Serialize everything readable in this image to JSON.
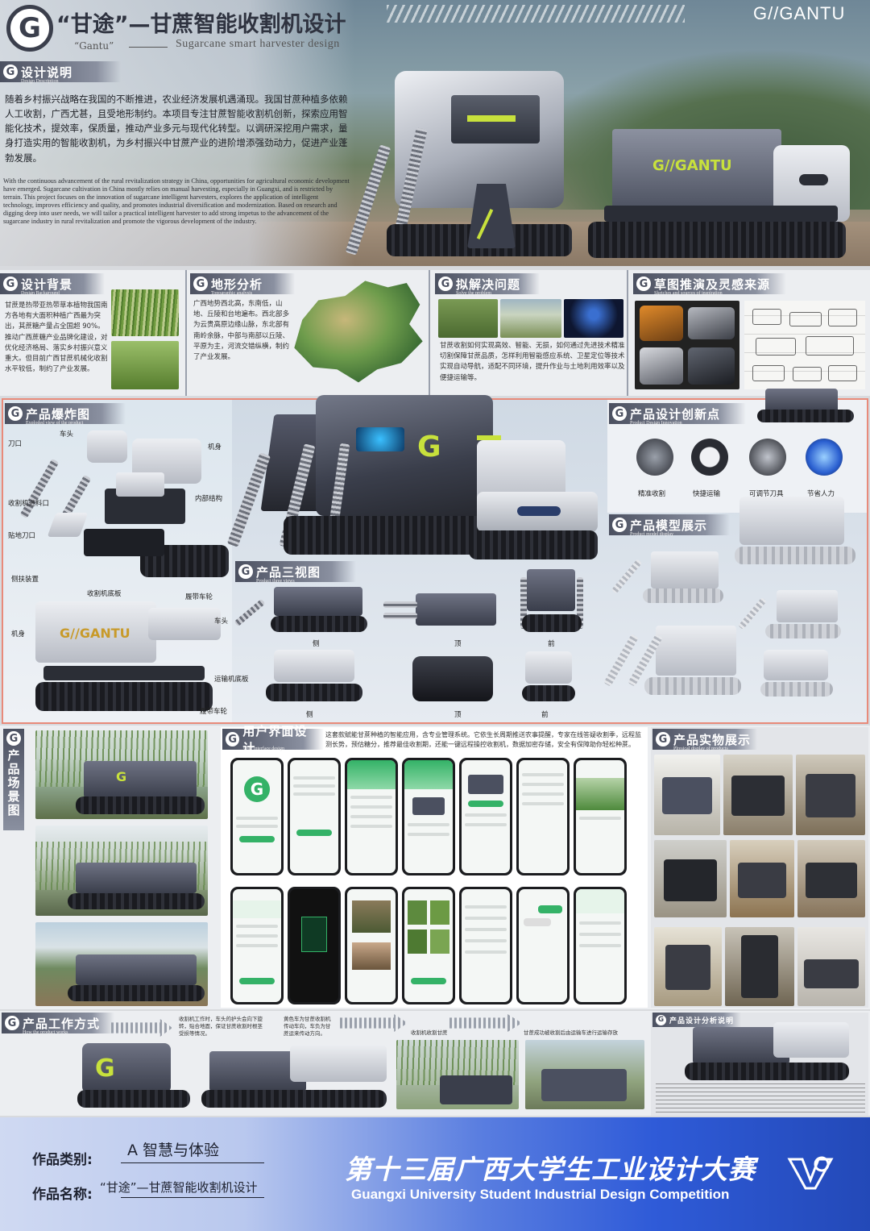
{
  "header": {
    "title": "“甘途”—甘蔗智能收割机设计",
    "subtitle_cn": "“Gantu”",
    "subtitle_en": "Sugarcane smart harvester design",
    "brand": "G//GANTU",
    "machine_brand": "G//GANTU"
  },
  "design_intro": {
    "title": "设计说明",
    "subtitle": "Design Description",
    "text_cn": "随着乡村振兴战略在我国的不断推进，农业经济发展机遇涌现。我国甘蔗种植多依赖人工收割，广西尤甚，且受地形制约。本项目专注甘蔗智能收割机创新，探索应用智能化技术，提效率，保质量，推动产业多元与现代化转型。以调研深挖用户需求，量身打造实用的智能收割机，为乡村振兴中甘蔗产业的进阶增添强劲动力，促进产业蓬勃发展。",
    "text_en": "With the continuous advancement of the rural revitalization strategy in China, opportunities for agricultural economic development have emerged. Sugarcane cultivation in China mostly relies on manual harvesting, especially in Guangxi, and is restricted by terrain. This project focuses on the innovation of sugarcane intelligent harvesters, explores the application of intelligent technology, improves efficiency and quality, and promotes industrial diversification and modernization. Based on research and digging deep into user needs, we will tailor a practical intelligent harvester to add strong impetus to the advancement of the sugarcane industry in rural revitalization and promote the vigorous development of the industry."
  },
  "background": {
    "title": "设计背景",
    "subtitle": "Design Background",
    "text": "甘蔗是热带亚热带草本植物我国南方各地有大面积种植广西最为突出，其蔗糖产量占全国超 90%。推动广西蔗糖产业品牌化建设，对优化经济格局、落实乡村振兴意义重大。但目前广西甘蔗机械化收割水平较低，制约了产业发展。"
  },
  "terrain": {
    "title": "地形分析",
    "subtitle": "Topographic analysis",
    "text": "广西地势西北高，东南低，山地、丘陵和台地遍布。西北部多为云贵高原边缘山脉，东北部有南岭余脉，中部与南部以丘陵、平原为主，河流交错纵横，制约了产业发展。"
  },
  "problem": {
    "title": "拟解决问题",
    "subtitle": "Solve the problem",
    "text": "甘蔗收割如何实现高效、智能、无损，如何通过先进技术精准切割保障甘蔗品质，怎样利用智能感应系统、卫星定位等技术实现自动导航，适配不同环境，提升作业与土地利用效率以及便捷运输等。"
  },
  "sketch": {
    "title": "草图推演及灵感来源",
    "subtitle": "Sketches and sources of inspiration"
  },
  "explode": {
    "title": "产品爆炸图",
    "subtitle": "Exploded view of the product",
    "labels": [
      "刀口",
      "车头",
      "机身",
      "内部结构",
      "收割机进料口",
      "贴地刀口",
      "侧扶装置",
      "收割机底板",
      "履带车轮",
      "机身",
      "车头",
      "运输机底板",
      "履带车轮"
    ]
  },
  "innovation": {
    "title": "产品设计创新点",
    "subtitle": "Product Design Innovation",
    "items": [
      "精准收割",
      "快捷运输",
      "可调节刀具",
      "节省人力"
    ]
  },
  "three_view": {
    "title": "产品三视图",
    "subtitle": "Product three views",
    "labels": [
      "侧",
      "顶",
      "前",
      "侧",
      "顶",
      "前"
    ]
  },
  "model": {
    "title": "产品模型展示",
    "subtitle": "Product model display"
  },
  "scene": {
    "title": "产品场景图",
    "subtitle": "Product scenario diagram"
  },
  "ui": {
    "title": "用户界面设计",
    "subtitle": "User interface design",
    "text": "这套款赋能甘蔗种植的智能应用，含专业管理系统。它依生长周期推送农事提醒，专家在线答疑收割季，远程监测长势，预估糖分，推荐最佳收割期，还能一键远程操控收割机，数据加密存储，安全有保障助你轻松种蔗。"
  },
  "physical": {
    "title": "产品实物展示",
    "subtitle": "Physical display of products"
  },
  "working": {
    "title": "产品工作方式",
    "subtitle": "How the product works",
    "step1": "收割机工作时，车头的护头会向下旋转，贴合地面，保证甘蔗收割时根茎受损等情况。",
    "step2": "黄色车为甘蔗收割机传动车向，车负为甘蔗运来传动方向。",
    "step3": "收割机收割甘蔗",
    "step4": "甘蔗成功被收割后由运输车进行运输存放"
  },
  "analysis": {
    "title": "产品设计分析说明"
  },
  "footer": {
    "category_label": "作品类别:",
    "category_value": "A 智慧与体验",
    "name_label": "作品名称:",
    "name_value": "“甘途”—甘蔗智能收割机设计",
    "competition_cn": "第十三届广西大学生工业设计大赛",
    "competition_en": "Guangxi University Student Industrial Design Competition"
  },
  "colors": {
    "accent": "#c8e13c",
    "machine": "#4b5060",
    "app_green": "#34b267",
    "footer_blue": "#2f5bd8"
  }
}
